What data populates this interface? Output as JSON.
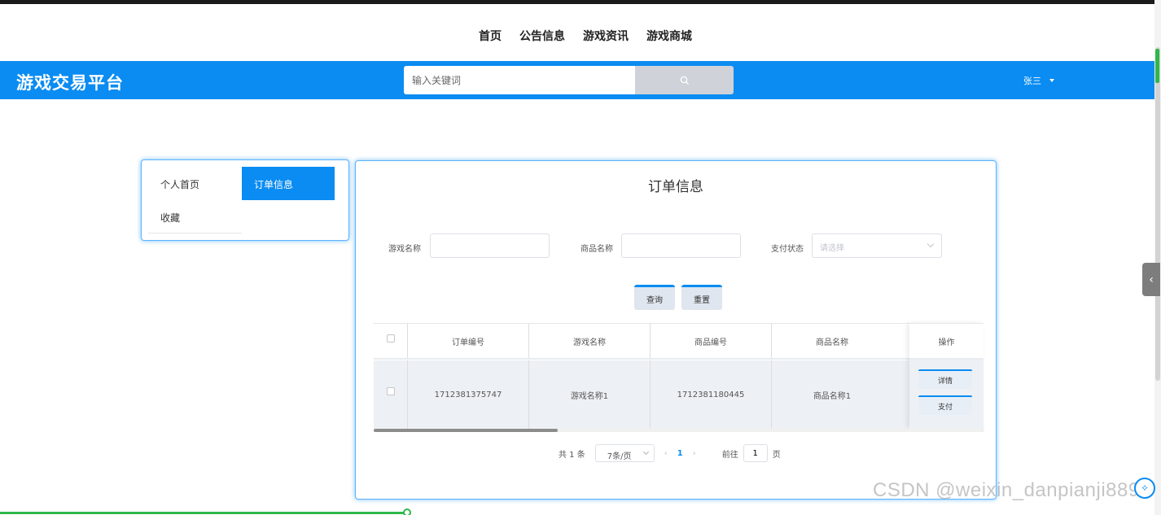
{
  "nav": {
    "items": [
      "首页",
      "公告信息",
      "游戏资讯",
      "游戏商城"
    ]
  },
  "header": {
    "brand": "游戏交易平台",
    "search_placeholder": "输入关键词",
    "user": "张三",
    "color": "#0a8cf2"
  },
  "sidebar": {
    "items": [
      {
        "label": "个人首页"
      },
      {
        "label": "订单信息",
        "active": true
      },
      {
        "label": "收藏"
      }
    ]
  },
  "main": {
    "title": "订单信息",
    "filters": {
      "game_name_label": "游戏名称",
      "product_name_label": "商品名称",
      "pay_status_label": "支付状态",
      "pay_status_placeholder": "请选择"
    },
    "buttons": {
      "query": "查询",
      "reset": "重置"
    },
    "table": {
      "columns": [
        "订单编号",
        "游戏名称",
        "商品编号",
        "商品名称",
        "操作"
      ],
      "rows": [
        {
          "order_no": "1712381375747",
          "game_name": "游戏名称1",
          "product_no": "1712381180445",
          "product_name": "商品名称1",
          "actions": [
            "详情",
            "支付"
          ]
        }
      ]
    },
    "pagination": {
      "total": "共 1 条",
      "page_size": "7条/页",
      "current_page": "1",
      "goto_label": "前往",
      "goto_value": "1",
      "page_suffix": "页"
    }
  },
  "watermark": "CSDN @weixin_danpianji889"
}
